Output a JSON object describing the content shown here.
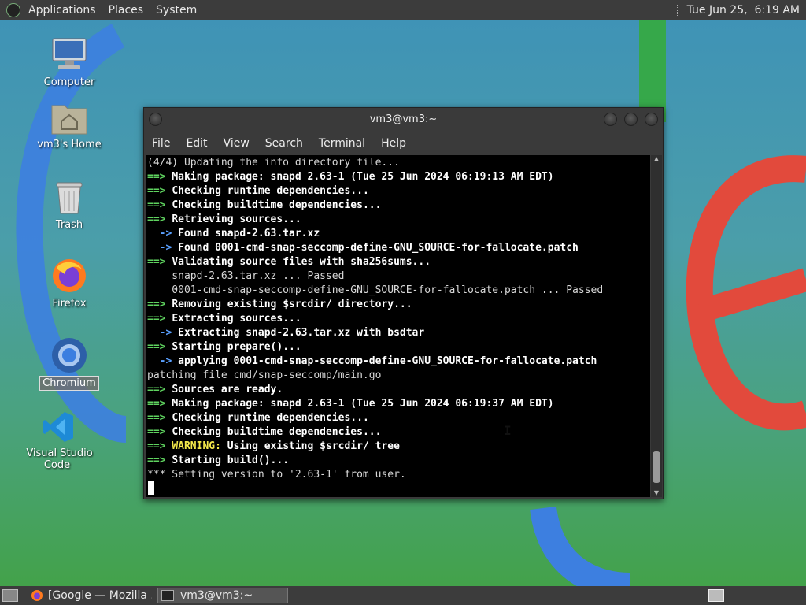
{
  "top_panel": {
    "menus": [
      "Applications",
      "Places",
      "System"
    ],
    "clock": "Tue Jun 25,  6:19 AM"
  },
  "desktop_icons": [
    {
      "label": "Computer",
      "icon": "computer-icon"
    },
    {
      "label": "vm3's Home",
      "icon": "home-folder-icon"
    },
    {
      "label": "Trash",
      "icon": "trash-icon"
    },
    {
      "label": "Firefox",
      "icon": "firefox-icon"
    },
    {
      "label": "Chromium",
      "icon": "chromium-icon"
    },
    {
      "label": "Visual Studio Code",
      "icon": "vscode-icon"
    }
  ],
  "terminal": {
    "title": "vm3@vm3:~",
    "menu": [
      "File",
      "Edit",
      "View",
      "Search",
      "Terminal",
      "Help"
    ],
    "lines": [
      [
        [
          "",
          "(4/4) Updating the info directory file..."
        ]
      ],
      [
        [
          "g",
          "==> "
        ],
        [
          "w",
          "Making package: snapd 2.63-1 (Tue 25 Jun 2024 06:19:13 AM EDT)"
        ]
      ],
      [
        [
          "g",
          "==> "
        ],
        [
          "w",
          "Checking runtime dependencies..."
        ]
      ],
      [
        [
          "g",
          "==> "
        ],
        [
          "w",
          "Checking buildtime dependencies..."
        ]
      ],
      [
        [
          "g",
          "==> "
        ],
        [
          "w",
          "Retrieving sources..."
        ]
      ],
      [
        [
          "b",
          "  -> "
        ],
        [
          "w",
          "Found snapd-2.63.tar.xz"
        ]
      ],
      [
        [
          "b",
          "  -> "
        ],
        [
          "w",
          "Found 0001-cmd-snap-seccomp-define-GNU_SOURCE-for-fallocate.patch"
        ]
      ],
      [
        [
          "g",
          "==> "
        ],
        [
          "w",
          "Validating source files with sha256sums..."
        ]
      ],
      [
        [
          "",
          "    snapd-2.63.tar.xz ... Passed"
        ]
      ],
      [
        [
          "",
          "    0001-cmd-snap-seccomp-define-GNU_SOURCE-for-fallocate.patch ... Passed"
        ]
      ],
      [
        [
          "g",
          "==> "
        ],
        [
          "w",
          "Removing existing $srcdir/ directory..."
        ]
      ],
      [
        [
          "g",
          "==> "
        ],
        [
          "w",
          "Extracting sources..."
        ]
      ],
      [
        [
          "b",
          "  -> "
        ],
        [
          "w",
          "Extracting snapd-2.63.tar.xz with bsdtar"
        ]
      ],
      [
        [
          "g",
          "==> "
        ],
        [
          "w",
          "Starting prepare()..."
        ]
      ],
      [
        [
          "b",
          "  -> "
        ],
        [
          "w",
          "applying 0001-cmd-snap-seccomp-define-GNU_SOURCE-for-fallocate.patch"
        ]
      ],
      [
        [
          "",
          "patching file cmd/snap-seccomp/main.go"
        ]
      ],
      [
        [
          "g",
          "==> "
        ],
        [
          "w",
          "Sources are ready."
        ]
      ],
      [
        [
          "g",
          "==> "
        ],
        [
          "w",
          "Making package: snapd 2.63-1 (Tue 25 Jun 2024 06:19:37 AM EDT)"
        ]
      ],
      [
        [
          "g",
          "==> "
        ],
        [
          "w",
          "Checking runtime dependencies..."
        ]
      ],
      [
        [
          "g",
          "==> "
        ],
        [
          "w",
          "Checking buildtime dependencies..."
        ]
      ],
      [
        [
          "g",
          "==> "
        ],
        [
          "y",
          "WARNING:"
        ],
        [
          "w",
          " Using existing $srcdir/ tree"
        ]
      ],
      [
        [
          "g",
          "==> "
        ],
        [
          "w",
          "Starting build()..."
        ]
      ],
      [
        [
          "",
          "*** Setting version to '2.63-1' from user."
        ]
      ]
    ]
  },
  "taskbar": {
    "tasks": [
      {
        "label": "[Google — Mozilla ...",
        "icon": "firefox-icon"
      },
      {
        "label": "vm3@vm3:~",
        "icon": "terminal-icon"
      }
    ]
  }
}
